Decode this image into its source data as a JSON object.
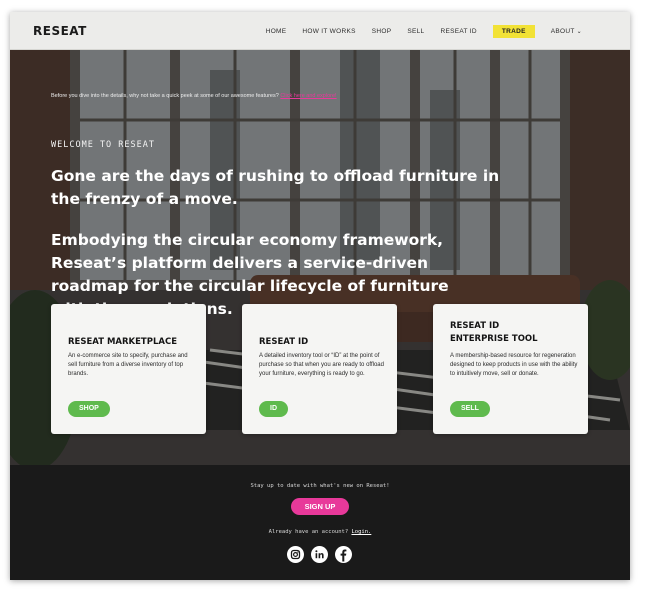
{
  "header": {
    "logo": "RESEAT",
    "nav": [
      "HOME",
      "HOW IT WORKS",
      "SHOP",
      "SELL",
      "RESEAT ID",
      "TRADE",
      "ABOUT"
    ]
  },
  "hero": {
    "notice_text": "Before you dive into the details, why not take a quick peek at some of our awesome features?",
    "notice_link": "Click here and explore!",
    "welcome": "WELCOME TO RESEAT",
    "headline": "Gone are the days of rushing to offload furniture in the frenzy of a move.",
    "subhead": "Embodying the circular economy framework, Reseat’s platform delivers a service-driven roadmap for the circular lifecycle of furniture with three solutions."
  },
  "cards": [
    {
      "title": "RESEAT MARKETPLACE",
      "description": "An e-commerce site to specify, purchase and sell furniture from a diverse inventory of top brands.",
      "button": "SHOP"
    },
    {
      "title": "RESEAT ID",
      "description": "A detailed inventory tool or “ID” at the point of purchase so that when you are ready to offload your furniture, everything is ready to go.",
      "button": "ID"
    },
    {
      "title": "RESEAT ID ENTERPRISE TOOL",
      "description": "A membership-based resource for regeneration designed to keep products in use with the ability to intuitively move, sell or donate.",
      "button": "SELL"
    }
  ],
  "footer": {
    "newsletter": "Stay up to date with what's new on Reseat!",
    "signup": "SIGN UP",
    "account_text": "Already have an account?",
    "login": "Login."
  },
  "social_icons": [
    "instagram-icon",
    "linkedin-icon",
    "facebook-icon"
  ],
  "colors": {
    "accent_yellow": "#f2e236",
    "button_green": "#5fba4d",
    "signup_pink": "#e8399a",
    "footer_bg": "#1a1a1a"
  }
}
